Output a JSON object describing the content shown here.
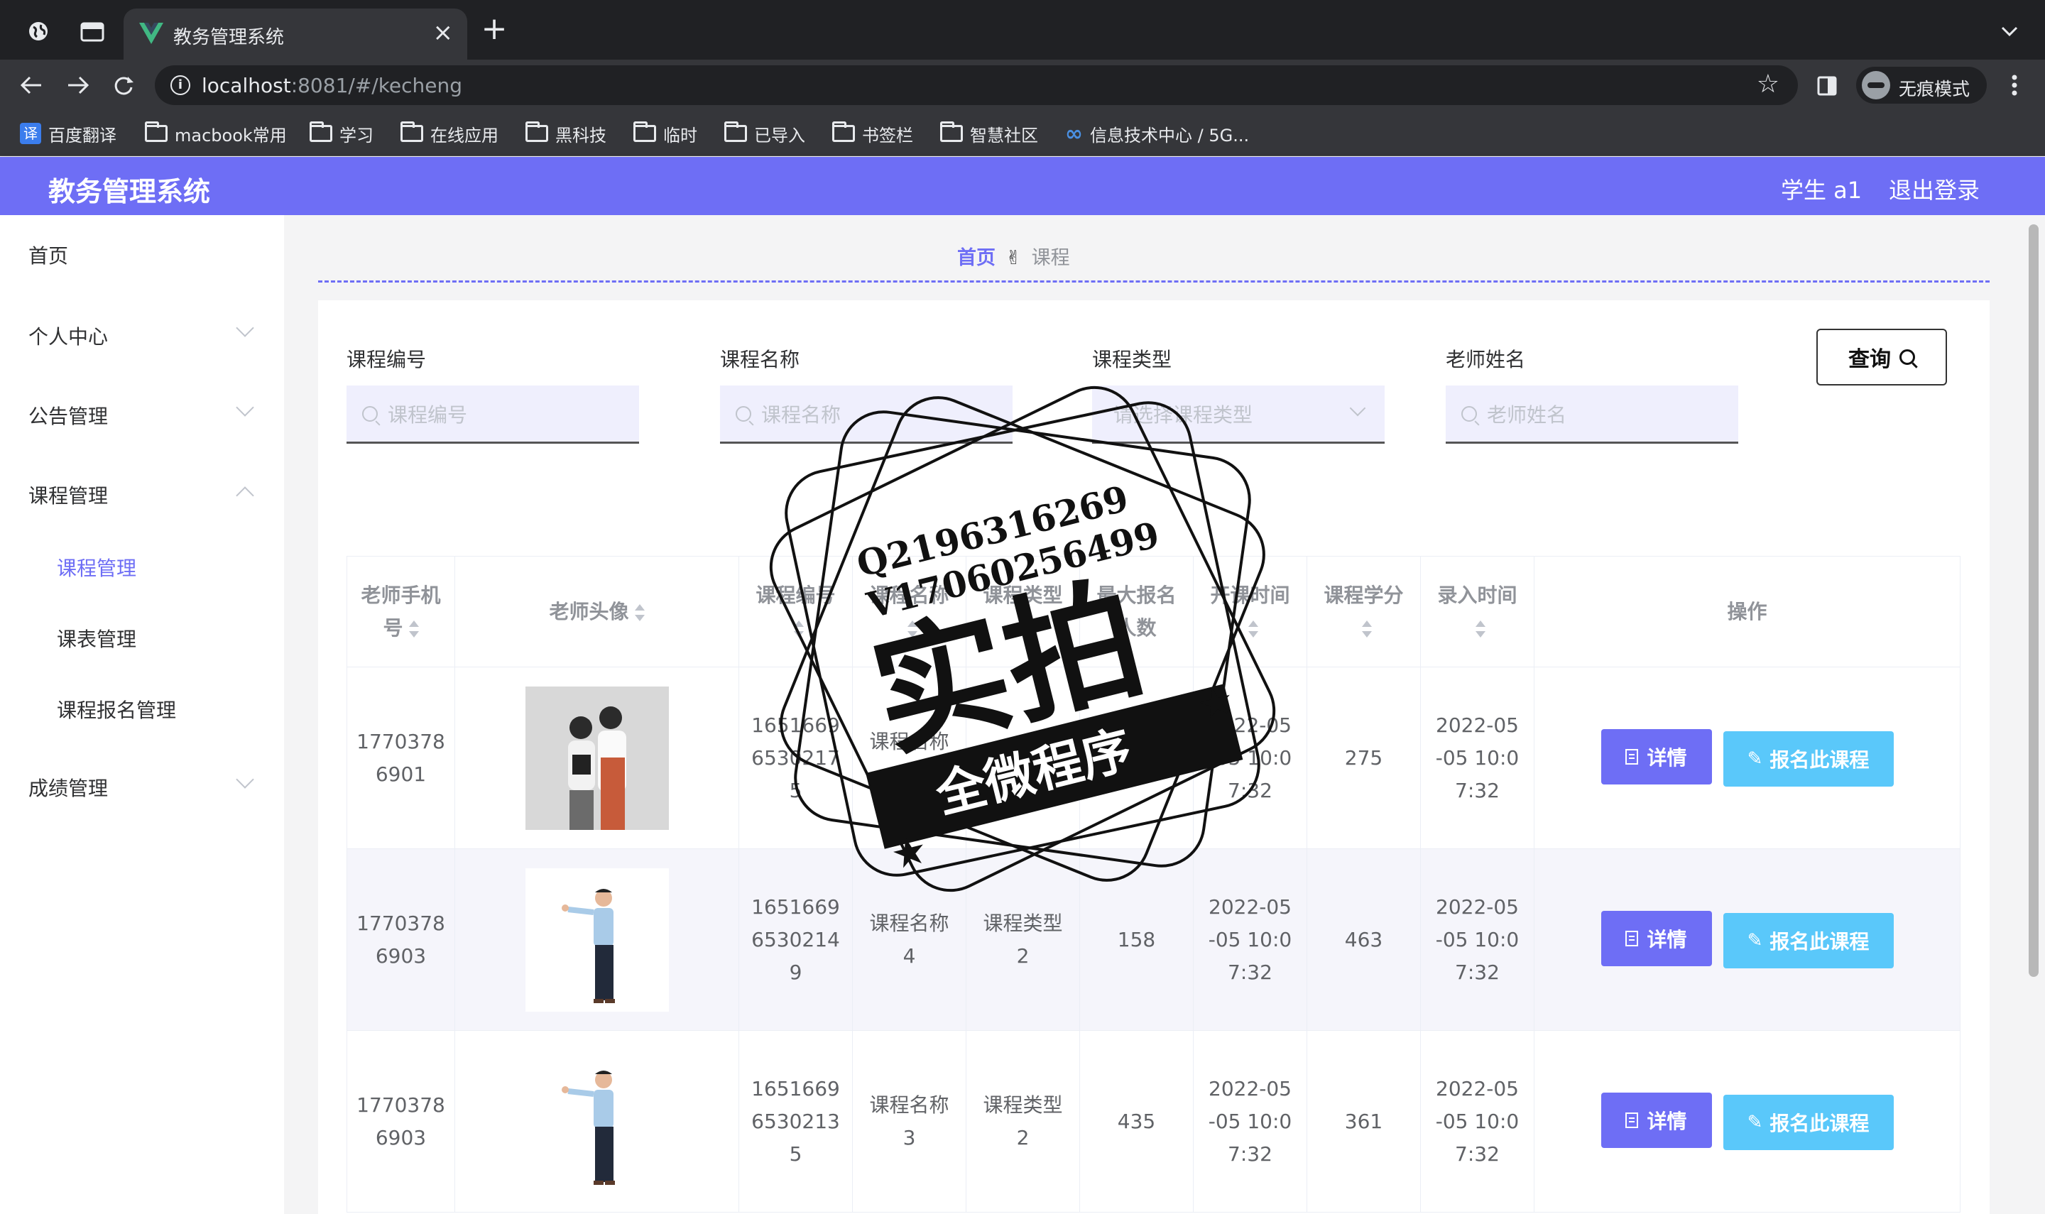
{
  "browser": {
    "tab_title": "教务管理系统",
    "tab_close": "×",
    "new_tab": "+",
    "url_host": "localhost",
    "url_rest": ":8081/#/kecheng",
    "incognito_label": "无痕模式",
    "bookmarks": [
      {
        "label": "百度翻译",
        "icon": "translate-icon"
      },
      {
        "label": "macbook常用",
        "icon": "folder-icon"
      },
      {
        "label": "学习",
        "icon": "folder-icon"
      },
      {
        "label": "在线应用",
        "icon": "folder-icon"
      },
      {
        "label": "黑科技",
        "icon": "folder-icon"
      },
      {
        "label": "临时",
        "icon": "folder-icon"
      },
      {
        "label": "已导入",
        "icon": "folder-icon"
      },
      {
        "label": "书签栏",
        "icon": "folder-icon"
      },
      {
        "label": "智慧社区",
        "icon": "folder-icon"
      },
      {
        "label": "信息技术中心 / 5G...",
        "icon": "infinity-icon"
      }
    ]
  },
  "header": {
    "title": "教务管理系统",
    "user": "学生 a1",
    "logout": "退出登录",
    "color": "#6e6ef5"
  },
  "sidebar": {
    "items": [
      {
        "label": "首页"
      },
      {
        "label": "个人中心"
      },
      {
        "label": "公告管理"
      },
      {
        "label": "课程管理"
      },
      {
        "label": "成绩管理"
      }
    ],
    "sub_items": [
      {
        "label": "课程管理",
        "active": true
      },
      {
        "label": "课表管理"
      },
      {
        "label": "课程报名管理"
      }
    ]
  },
  "breadcrumb": {
    "home": "首页",
    "separator": "✌",
    "current": "课程"
  },
  "filters": {
    "course_no": {
      "label": "课程编号",
      "placeholder": "课程编号"
    },
    "course_name": {
      "label": "课程名称",
      "placeholder": "课程名称"
    },
    "course_type": {
      "label": "课程类型",
      "placeholder": "请选择课程类型"
    },
    "teacher_name": {
      "label": "老师姓名",
      "placeholder": "老师姓名"
    },
    "query_button": "查询"
  },
  "table": {
    "columns": [
      "老师手机号",
      "老师头像",
      "课程编号",
      "课程名称",
      "课程类型",
      "最大报名人数",
      "开课时间",
      "课程学分",
      "录入时间",
      "操作"
    ],
    "rows": [
      {
        "phone": "17703786901",
        "course_no": "16516696530217 5",
        "name": "课程名称5",
        "type": "课程类型",
        "max": "",
        "start": "2022-05-05 10:07:32",
        "credit": "275",
        "created": "2022-05-05 10:07:32",
        "avatar": "teacher-duo-photo"
      },
      {
        "phone": "17703786903",
        "course_no": "16516696530214 9",
        "name": "课程名称4",
        "type": "课程类型2",
        "max": "158",
        "start": "2022-05-05 10:07:32",
        "credit": "463",
        "created": "2022-05-05 10:07:32",
        "avatar": "teacher-man-photo"
      },
      {
        "phone": "17703786903",
        "course_no": "16516696530213 5",
        "name": "课程名称3",
        "type": "课程类型2",
        "max": "435",
        "start": "2022-05-05 10:07:32",
        "credit": "361",
        "created": "2022-05-05 10:07:32",
        "avatar": "teacher-man-photo"
      }
    ],
    "cells": {
      "r0": {
        "phone": [
          "1770378",
          "6901"
        ],
        "course_no": [
          "1651669",
          "6530217",
          "5"
        ],
        "name": [
          "课程名称",
          "5"
        ],
        "type": [
          ""
        ],
        "max": [
          ""
        ],
        "start": [
          "2022-05",
          "-05 10:0",
          "7:32"
        ],
        "credit": "275",
        "created": [
          "2022-05",
          "-05 10:0",
          "7:32"
        ]
      },
      "r1": {
        "phone": [
          "1770378",
          "6903"
        ],
        "course_no": [
          "1651669",
          "6530214",
          "9"
        ],
        "name": [
          "课程名称",
          "4"
        ],
        "type": [
          "课程类型",
          "2"
        ],
        "max": [
          "158"
        ],
        "start": [
          "2022-05",
          "-05 10:0",
          "7:32"
        ],
        "credit": "463",
        "created": [
          "2022-05",
          "-05 10:0",
          "7:32"
        ]
      },
      "r2": {
        "phone": [
          "1770378",
          "6903"
        ],
        "course_no": [
          "1651669",
          "6530213",
          "5"
        ],
        "name": [
          "课程名称",
          "3"
        ],
        "type": [
          "课程类型",
          "2"
        ],
        "max": [
          "435"
        ],
        "start": [
          "2022-05",
          "-05 10:0",
          "7:32"
        ],
        "credit": "361",
        "created": [
          "2022-05",
          "-05 10:0",
          "7:32"
        ]
      }
    },
    "headers_wrapped": {
      "phone": [
        "老师手机",
        "号"
      ],
      "avatar": "老师头像",
      "course_no": "课程编号",
      "name": "课程名称",
      "type": "课程类型",
      "max": [
        "最大报名",
        "人数"
      ],
      "start": "开课时间",
      "credit": "课程学分",
      "created": "录入时间",
      "action": "操作"
    },
    "detail_button": "详情",
    "enroll_button": "报名此课程"
  },
  "watermark": {
    "line1": "Q2196316269",
    "line2": "V17060256499",
    "big": "实拍",
    "banner": "全微程序"
  },
  "colors": {
    "accent": "#6e6ef5",
    "enroll": "#5ac8fa",
    "input_bg": "#efeffd"
  }
}
